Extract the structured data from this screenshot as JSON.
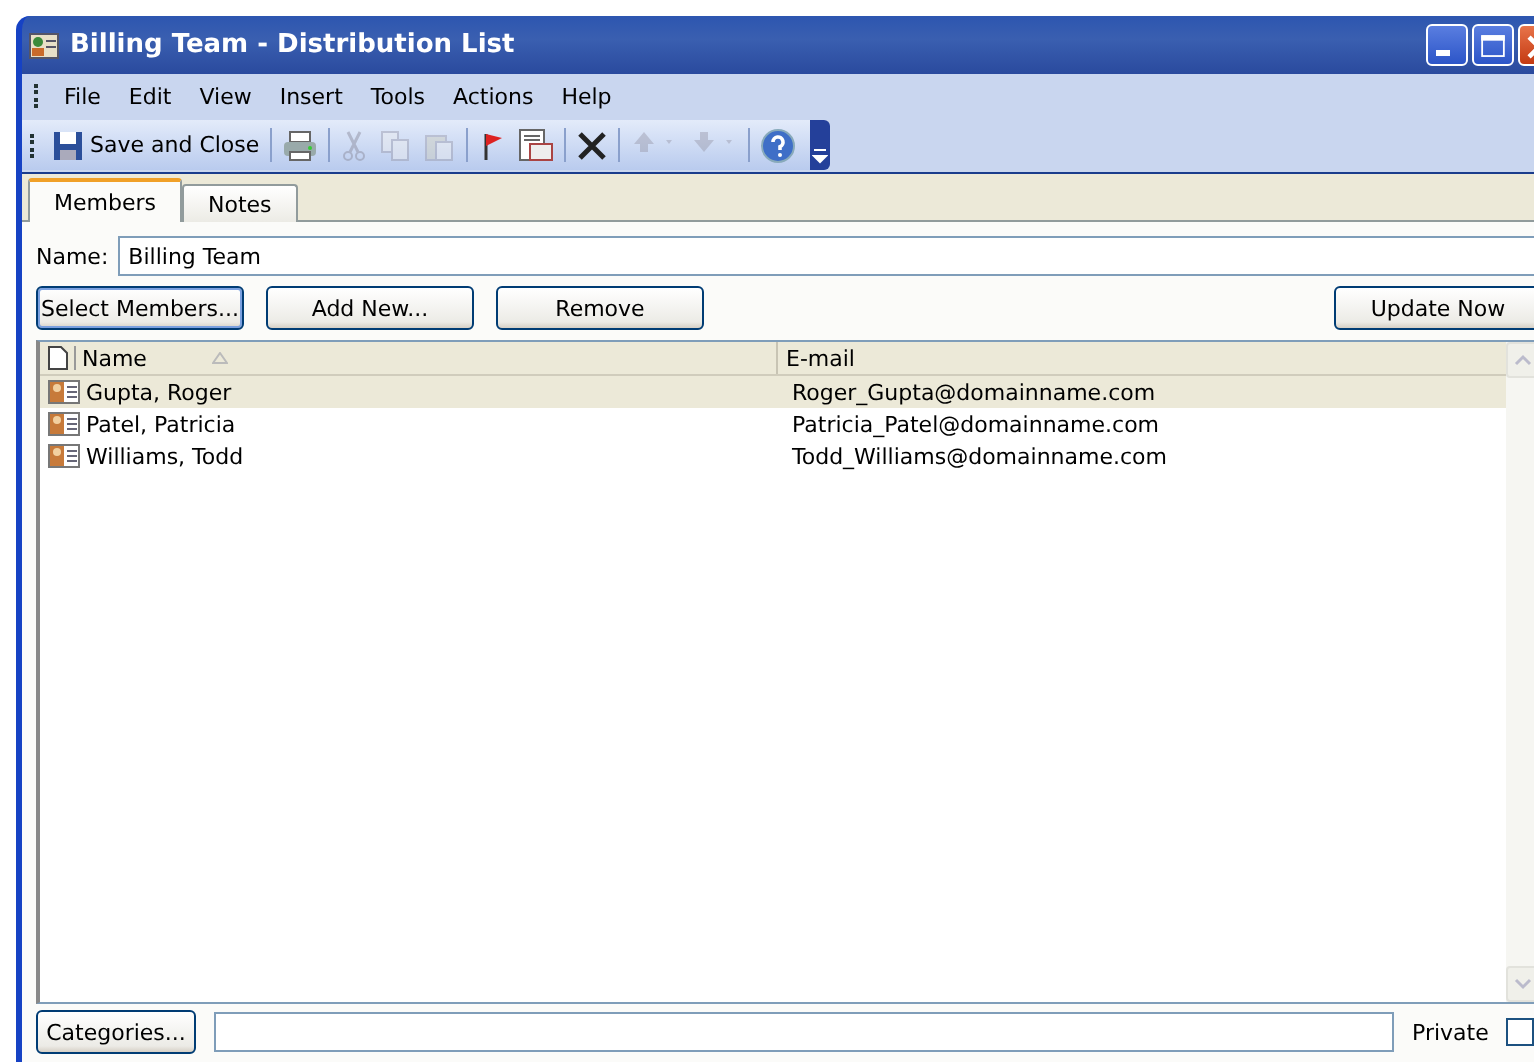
{
  "window": {
    "title": "Billing Team - Distribution List"
  },
  "menu": [
    "File",
    "Edit",
    "View",
    "Insert",
    "Tools",
    "Actions",
    "Help"
  ],
  "toolbar": [
    {
      "label": "Save and Close",
      "disabled": false
    },
    {
      "disabled": false
    },
    {
      "disabled": true
    },
    {
      "disabled": true
    },
    {
      "disabled": true
    },
    {
      "disabled": false
    },
    {
      "disabled": false
    },
    {
      "disabled": false
    },
    {
      "disabled": true
    },
    {
      "disabled": true
    },
    {
      "disabled": false
    }
  ],
  "tabs": [
    {
      "label": "Members",
      "selected": true
    },
    {
      "label": "Notes",
      "selected": false
    }
  ],
  "name_field": {
    "label": "Name:",
    "value": "Billing Team"
  },
  "buttons": [
    "Select Members...",
    "Add New...",
    "Remove"
  ],
  "update_button": "Update Now",
  "table": {
    "columns": [
      "Name",
      "E-mail"
    ],
    "rows": [
      {
        "name": "Gupta, Roger",
        "email": "Roger_Gupta@domainname.com",
        "selected": true
      },
      {
        "name": "Patel, Patricia",
        "email": "Patricia_Patel@domainname.com",
        "selected": false
      },
      {
        "name": "Williams, Todd",
        "email": "Todd_Williams@domainname.com",
        "selected": false
      }
    ]
  },
  "categories_button": "Categories...",
  "private": {
    "label": "Private",
    "checked": false
  }
}
